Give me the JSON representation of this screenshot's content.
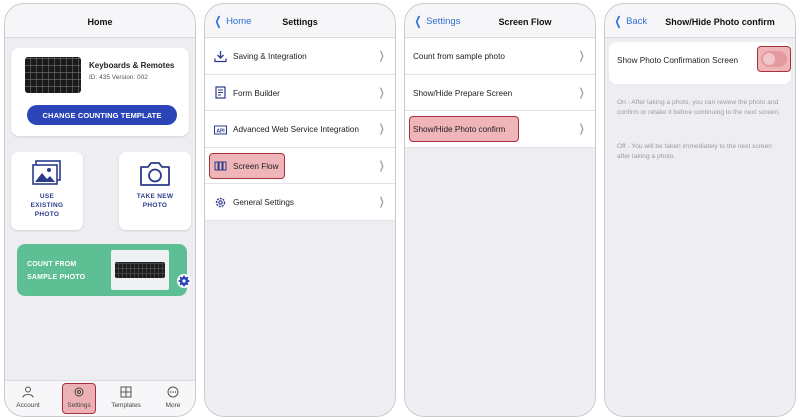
{
  "screen1": {
    "title": "Home",
    "template": {
      "name": "Keyboards & Remotes",
      "meta": "ID: 435 Version: 002"
    },
    "change_button": "CHANGE COUNTING TEMPLATE",
    "use_existing": "USE\nEXISTING\nPHOTO",
    "take_new": "TAKE NEW\nPHOTO",
    "sample": "COUNT FROM\nSAMPLE PHOTO",
    "tabs": [
      "Account",
      "Settings",
      "Templates",
      "More"
    ]
  },
  "screen2": {
    "back": "Home",
    "title": "Settings",
    "items": [
      "Saving & Integration",
      "Form Builder",
      "Advanced Web Service Integration",
      "Screen Flow",
      "General Settings"
    ],
    "highlight_index": 3
  },
  "screen3": {
    "back": "Settings",
    "title": "Screen Flow",
    "items": [
      "Count from sample photo",
      "Show/Hide Prepare Screen",
      "Show/Hide Photo confirm"
    ],
    "highlight_index": 2
  },
  "screen4": {
    "back": "Back",
    "title": "Show/Hide Photo confirm",
    "toggle_label": "Show Photo Confirmation Screen",
    "toggle_on": false,
    "desc_on": "On - After taking a photo, you can review the photo and confirm or retake it before continuing to the next screen.",
    "desc_off": "Off - You will be taken immediately to the next screen after taking a photo."
  },
  "colors": {
    "accent_blue": "#2b45b8",
    "link_blue": "#2f6fd6",
    "sample_green": "#5fbf94",
    "highlight_red": "#a5313a"
  }
}
